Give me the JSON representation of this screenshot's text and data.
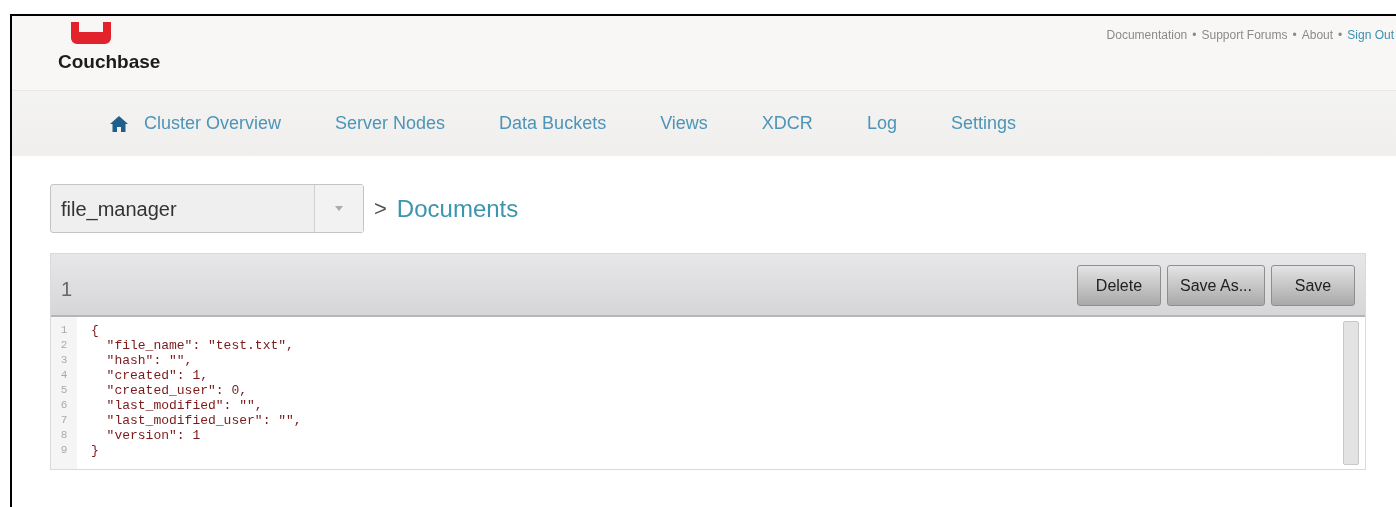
{
  "header": {
    "logo_text": "Couchbase",
    "links": [
      {
        "label": "Documentation",
        "kind": "muted"
      },
      {
        "label": "Support Forums",
        "kind": "muted"
      },
      {
        "label": "About",
        "kind": "muted"
      },
      {
        "label": "Sign Out",
        "kind": "accent"
      }
    ],
    "separator": "•"
  },
  "nav": {
    "items": [
      {
        "label": "Cluster Overview",
        "kind": "home"
      },
      {
        "label": "Server Nodes",
        "kind": "plain"
      },
      {
        "label": "Data Buckets",
        "kind": "plain"
      },
      {
        "label": "Views",
        "kind": "plain"
      },
      {
        "label": "XDCR",
        "kind": "plain"
      },
      {
        "label": "Log",
        "kind": "plain"
      },
      {
        "label": "Settings",
        "kind": "plain"
      }
    ]
  },
  "breadcrumb": {
    "bucket_select": {
      "value": "file_manager"
    },
    "separator": ">",
    "current": "Documents"
  },
  "editor": {
    "document_id": "1",
    "buttons": [
      "Delete",
      "Save As...",
      "Save"
    ],
    "lines": [
      {
        "number": "1",
        "code": "{"
      },
      {
        "number": "2",
        "code": "  \"file_name\": \"test.txt\","
      },
      {
        "number": "3",
        "code": "  \"hash\": \"\","
      },
      {
        "number": "4",
        "code": "  \"created\": 1,"
      },
      {
        "number": "5",
        "code": "  \"created_user\": 0,"
      },
      {
        "number": "6",
        "code": "  \"last_modified\": \"\","
      },
      {
        "number": "7",
        "code": "  \"last_modified_user\": \"\","
      },
      {
        "number": "8",
        "code": "  \"version\": 1"
      },
      {
        "number": "9",
        "code": "}"
      }
    ]
  }
}
